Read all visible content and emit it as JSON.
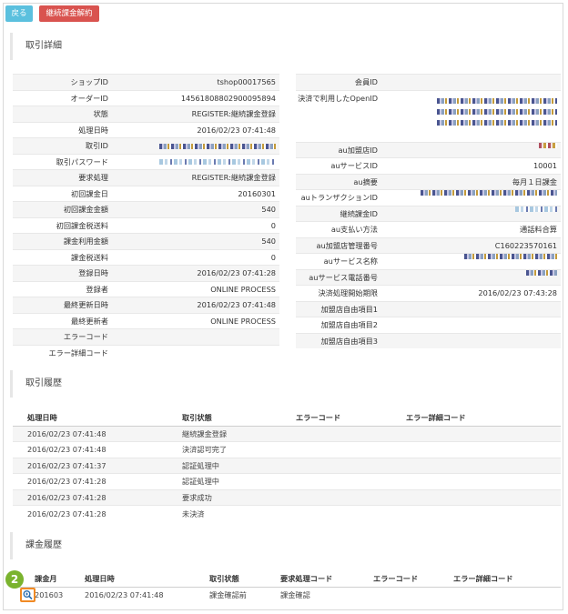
{
  "buttons": {
    "back": "戻る",
    "cancel": "継続課金解約"
  },
  "sections": {
    "detail": "取引詳細",
    "history": "取引履歴",
    "billing": "課金履歴"
  },
  "left_fields": [
    {
      "label": "ショップID",
      "value": "tshop00017565"
    },
    {
      "label": "オーダーID",
      "value": "1456180880290009589​4"
    },
    {
      "label": "状態",
      "value": "REGISTER:継続課金登録"
    },
    {
      "label": "処理日時",
      "value": "2016/02/23 07:41:48"
    },
    {
      "label": "取引ID",
      "value": "",
      "masked": true
    },
    {
      "label": "取引パスワード",
      "value": "",
      "masked": true
    },
    {
      "label": "要求処理",
      "value": "REGISTER:継続課金登録"
    },
    {
      "label": "初回課金日",
      "value": "20160301"
    },
    {
      "label": "初回課金金額",
      "value": "540"
    },
    {
      "label": "初回課金税送料",
      "value": "0"
    },
    {
      "label": "課金利用金額",
      "value": "540"
    },
    {
      "label": "課金税送料",
      "value": "0"
    },
    {
      "label": "登録日時",
      "value": "2016/02/23 07:41:28"
    },
    {
      "label": "登録者",
      "value": "ONLINE PROCESS"
    },
    {
      "label": "最終更新日時",
      "value": "2016/02/23 07:41:48"
    },
    {
      "label": "最終更新者",
      "value": "ONLINE PROCESS"
    },
    {
      "label": "エラーコード",
      "value": ""
    },
    {
      "label": "エラー詳細コード",
      "value": ""
    }
  ],
  "right_fields": [
    {
      "label": "会員ID",
      "value": ""
    },
    {
      "label": "決済で利用したOpenID",
      "value": "",
      "masked": true
    },
    {
      "label": "au加盟店ID",
      "value": "",
      "masked": true
    },
    {
      "label": "auサービスID",
      "value": "10001"
    },
    {
      "label": "au摘要",
      "value": "毎月１日課金"
    },
    {
      "label": "auトランザクションID",
      "value": "",
      "masked": true
    },
    {
      "label": "継続課金ID",
      "value": "",
      "masked": true
    },
    {
      "label": "au支払い方法",
      "value": "通話料合算"
    },
    {
      "label": "au加盟店管理番号",
      "value": "C160223570161"
    },
    {
      "label": "auサービス名称",
      "value": "",
      "masked": true
    },
    {
      "label": "auサービス電話番号",
      "value": "",
      "masked": true
    },
    {
      "label": "決済処理開始期限",
      "value": "2016/02/23 07:43:28"
    },
    {
      "label": "加盟店自由項目1",
      "value": ""
    },
    {
      "label": "加盟店自由項目2",
      "value": ""
    },
    {
      "label": "加盟店自由項目3",
      "value": ""
    }
  ],
  "history": {
    "columns": [
      "処理日時",
      "取引状態",
      "エラーコード",
      "エラー詳細コード"
    ],
    "rows": [
      [
        "2016/02/23 07:41:48",
        "継続課金登録",
        "",
        ""
      ],
      [
        "2016/02/23 07:41:48",
        "決済認可完了",
        "",
        ""
      ],
      [
        "2016/02/23 07:41:37",
        "認証処理中",
        "",
        ""
      ],
      [
        "2016/02/23 07:41:28",
        "認証処理中",
        "",
        ""
      ],
      [
        "2016/02/23 07:41:28",
        "要求成功",
        "",
        ""
      ],
      [
        "2016/02/23 07:41:28",
        "未決済",
        "",
        ""
      ]
    ]
  },
  "billing": {
    "columns": [
      "課金月",
      "処理日時",
      "取引状態",
      "要求処理コード",
      "エラーコード",
      "エラー詳細コード"
    ],
    "rows": [
      [
        "201603",
        "2016/02/23 07:41:48",
        "課金確認前",
        "課金確認",
        "",
        ""
      ]
    ]
  },
  "annotation_badge": "2",
  "icons": {
    "zoom": "magnifier-icon",
    "badge_color": "#7ab32e",
    "highlight_color": "#f08a24"
  }
}
